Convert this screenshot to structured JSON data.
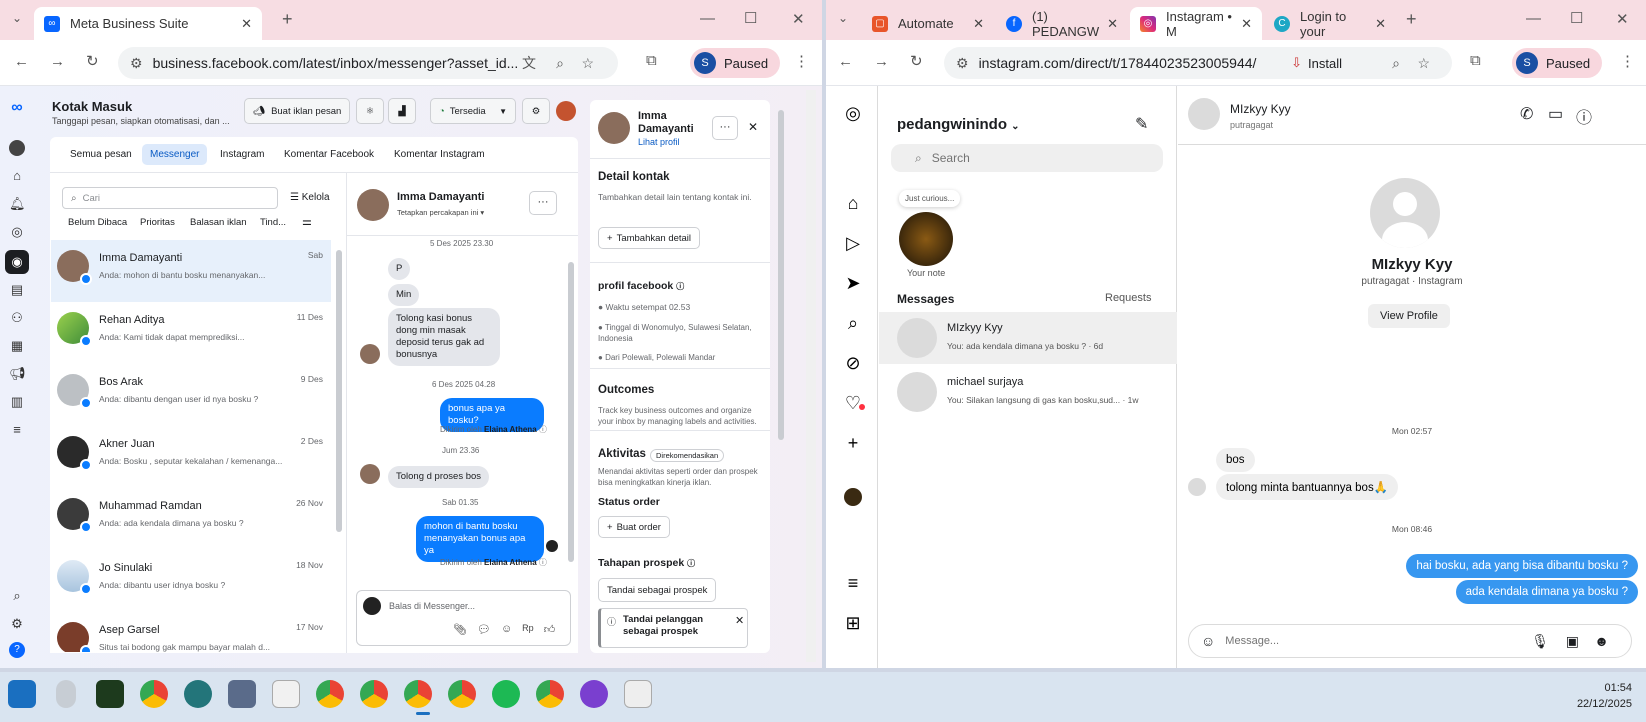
{
  "left_window": {
    "tab_title": "Meta Business Suite",
    "url": "business.facebook.com/latest/inbox/messenger?asset_id...",
    "profile_initial": "S",
    "profile_status": "Paused"
  },
  "inbox": {
    "title": "Kotak Masuk",
    "subtitle": "Tanggapi pesan, siapkan otomatisasi, dan ...",
    "create_ad_label": "Buat iklan pesan",
    "availability_label": "Tersedia",
    "tabs": [
      "Semua pesan",
      "Messenger",
      "Instagram",
      "Komentar Facebook",
      "Komentar Instagram"
    ],
    "search_placeholder": "Cari",
    "manage_label": "Kelola",
    "filters": [
      "Belum Dibaca",
      "Prioritas",
      "Balasan iklan",
      "Tind..."
    ],
    "conversations": [
      {
        "name": "Imma Damayanti",
        "preview": "Anda: mohon di bantu bosku menanyakan...",
        "date": "Sab"
      },
      {
        "name": "Rehan Aditya",
        "preview": "Anda: Kami tidak dapat memprediksi...",
        "date": "11 Des"
      },
      {
        "name": "Bos Arak",
        "preview": "Anda: dibantu dengan user id nya bosku ?",
        "date": "9 Des"
      },
      {
        "name": "Akner Juan",
        "preview": "Anda: Bosku , seputar kekalahan / kemenanga...",
        "date": "2 Des"
      },
      {
        "name": "Muhammad Ramdan",
        "preview": "Anda: ada kendala dimana ya bosku ?",
        "date": "26 Nov"
      },
      {
        "name": "Jo Sinulaki",
        "preview": "Anda: dibantu user idnya bosku ?",
        "date": "18 Nov"
      },
      {
        "name": "Asep Garsel",
        "preview": "Situs tai bodong gak mampu bayar malah d...",
        "date": "17 Nov"
      }
    ]
  },
  "thread": {
    "name": "Imma Damayanti",
    "sub": "Tetapkan percakapan ini",
    "date1": "5 Des 2025 23.30",
    "msg_p": "P",
    "msg_min": "Min",
    "msg_bonus": "Tolong kasi bonus dong min masak deposid terus gak ad bonusnya",
    "date2": "6 Des 2025 04.28",
    "msg_reply1": "bonus apa ya bosku?",
    "sent_by_1": "Dikirim oleh",
    "sender": "Elaina Athena",
    "date3": "Jum 23.36",
    "msg_proses": "Tolong d proses bos",
    "date4": "Sab 01.35",
    "msg_reply2": "mohon di bantu bosku menanyakan bonus apa ya",
    "sent_by_2": "Dikirim oleh",
    "composer_placeholder": "Balas di Messenger..."
  },
  "contact_panel": {
    "name": "Imma Damayanti",
    "view_profile": "Lihat profil",
    "detail_title": "Detail kontak",
    "detail_text": "Tambahkan detail lain tentang kontak ini.",
    "add_detail": "Tambahkan detail",
    "fb_profile_title": "profil facebook",
    "local_time": "Waktu setempat 02.53",
    "lives_in": "Tinggal di Wonomulyo, Sulawesi Selatan, Indonesia",
    "from": "Dari Polewali, Polewali Mandar",
    "outcomes_title": "Outcomes",
    "outcomes_text": "Track key business outcomes and organize your inbox by managing labels and activities.",
    "activity_title": "Aktivitas",
    "activity_badge": "Direkomendasikan",
    "activity_text": "Menandai aktivitas seperti order dan prospek bisa meningkatkan kinerja iklan.",
    "order_status": "Status order",
    "create_order": "Buat order",
    "prospect_stage": "Tahapan prospek",
    "mark_prospect": "Tandai sebagai prospek",
    "notice": "Tandai pelanggan sebagai prospek"
  },
  "right_window": {
    "tabs": [
      "Automate",
      "(1) PEDANGW",
      "Instagram • M",
      "Login to your"
    ],
    "url": "instagram.com/direct/t/17844023523005944/",
    "install_label": "Install",
    "profile_initial": "S",
    "profile_status": "Paused"
  },
  "instagram": {
    "account": "pedangwinindo",
    "search_placeholder": "Search",
    "note_bubble": "Just curious...",
    "note_label": "Your note",
    "messages_label": "Messages",
    "requests_label": "Requests",
    "threads": [
      {
        "name": "MIzkyy Kyy",
        "preview": "You: ada kendala dimana ya bosku ? · 6d"
      },
      {
        "name": "michael surjaya",
        "preview": "You: Silakan langsung di gas kan bosku,sud... · 1w"
      }
    ],
    "chat_name": "MIzkyy Kyy",
    "chat_user": "putragagat",
    "profile_name": "MIzkyy Kyy",
    "profile_sub": "putragagat · Instagram",
    "view_profile": "View Profile",
    "time1": "Mon 02:57",
    "in1": "bos",
    "in2": "tolong minta bantuannya bos🙏",
    "time2": "Mon 08:46",
    "out1": "hai bosku, ada yang bisa dibantu bosku ?",
    "out2": "ada kendala dimana ya bosku ?",
    "message_placeholder": "Message..."
  },
  "taskbar": {
    "time": "01:54",
    "date": "22/12/2025"
  }
}
